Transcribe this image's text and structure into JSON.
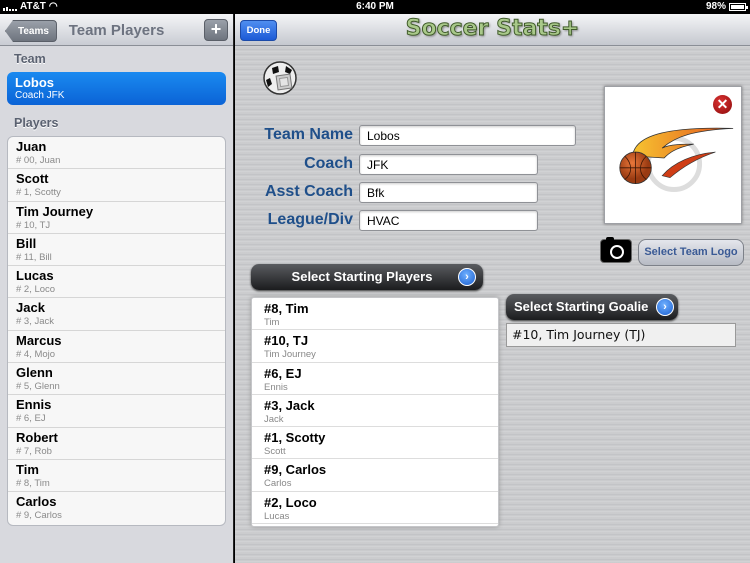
{
  "status_bar": {
    "carrier": "AT&T",
    "time": "6:40 PM",
    "battery": "98%"
  },
  "left_panel": {
    "back_label": "Teams",
    "title": "Team Players",
    "add_label": "+",
    "team_section": "Team",
    "team": {
      "name": "Lobos",
      "subtitle": "Coach JFK"
    },
    "players_section": "Players",
    "players": [
      {
        "name": "Juan",
        "detail": "# 00, Juan"
      },
      {
        "name": "Scott",
        "detail": "# 1, Scotty"
      },
      {
        "name": "Tim Journey",
        "detail": "# 10, TJ"
      },
      {
        "name": "Bill",
        "detail": "# 11, Bill"
      },
      {
        "name": "Lucas",
        "detail": "# 2, Loco"
      },
      {
        "name": "Jack",
        "detail": "# 3, Jack"
      },
      {
        "name": "Marcus",
        "detail": "# 4, Mojo"
      },
      {
        "name": "Glenn",
        "detail": "# 5, Glenn"
      },
      {
        "name": "Ennis",
        "detail": "# 6, EJ"
      },
      {
        "name": "Robert",
        "detail": "# 7, Rob"
      },
      {
        "name": "Tim",
        "detail": "# 8, Tim"
      },
      {
        "name": "Carlos",
        "detail": "# 9, Carlos"
      }
    ]
  },
  "right_panel": {
    "done_label": "Done",
    "app_title": "Soccer Stats+",
    "form": {
      "team_name_label": "Team Name",
      "team_name_value": "Lobos",
      "coach_label": "Coach",
      "coach_value": "JFK",
      "asst_coach_label": "Asst Coach",
      "asst_coach_value": "Bfk",
      "league_label": "League/Div",
      "league_value": "HVAC"
    },
    "select_logo_label": "Select Team Logo",
    "delete_logo_glyph": "✕",
    "select_players_label": "Select Starting Players",
    "select_goalie_label": "Select Starting Goalie",
    "arrow_glyph": "›",
    "goalie_value": "#10, Tim Journey (TJ)",
    "starters": [
      {
        "title": "#8, Tim",
        "name": "Tim"
      },
      {
        "title": "#10, TJ",
        "name": "Tim Journey"
      },
      {
        "title": "#6, EJ",
        "name": "Ennis"
      },
      {
        "title": "#3, Jack",
        "name": "Jack"
      },
      {
        "title": "#1, Scotty",
        "name": "Scott"
      },
      {
        "title": "#9, Carlos",
        "name": "Carlos"
      },
      {
        "title": "#2, Loco",
        "name": "Lucas"
      }
    ]
  }
}
